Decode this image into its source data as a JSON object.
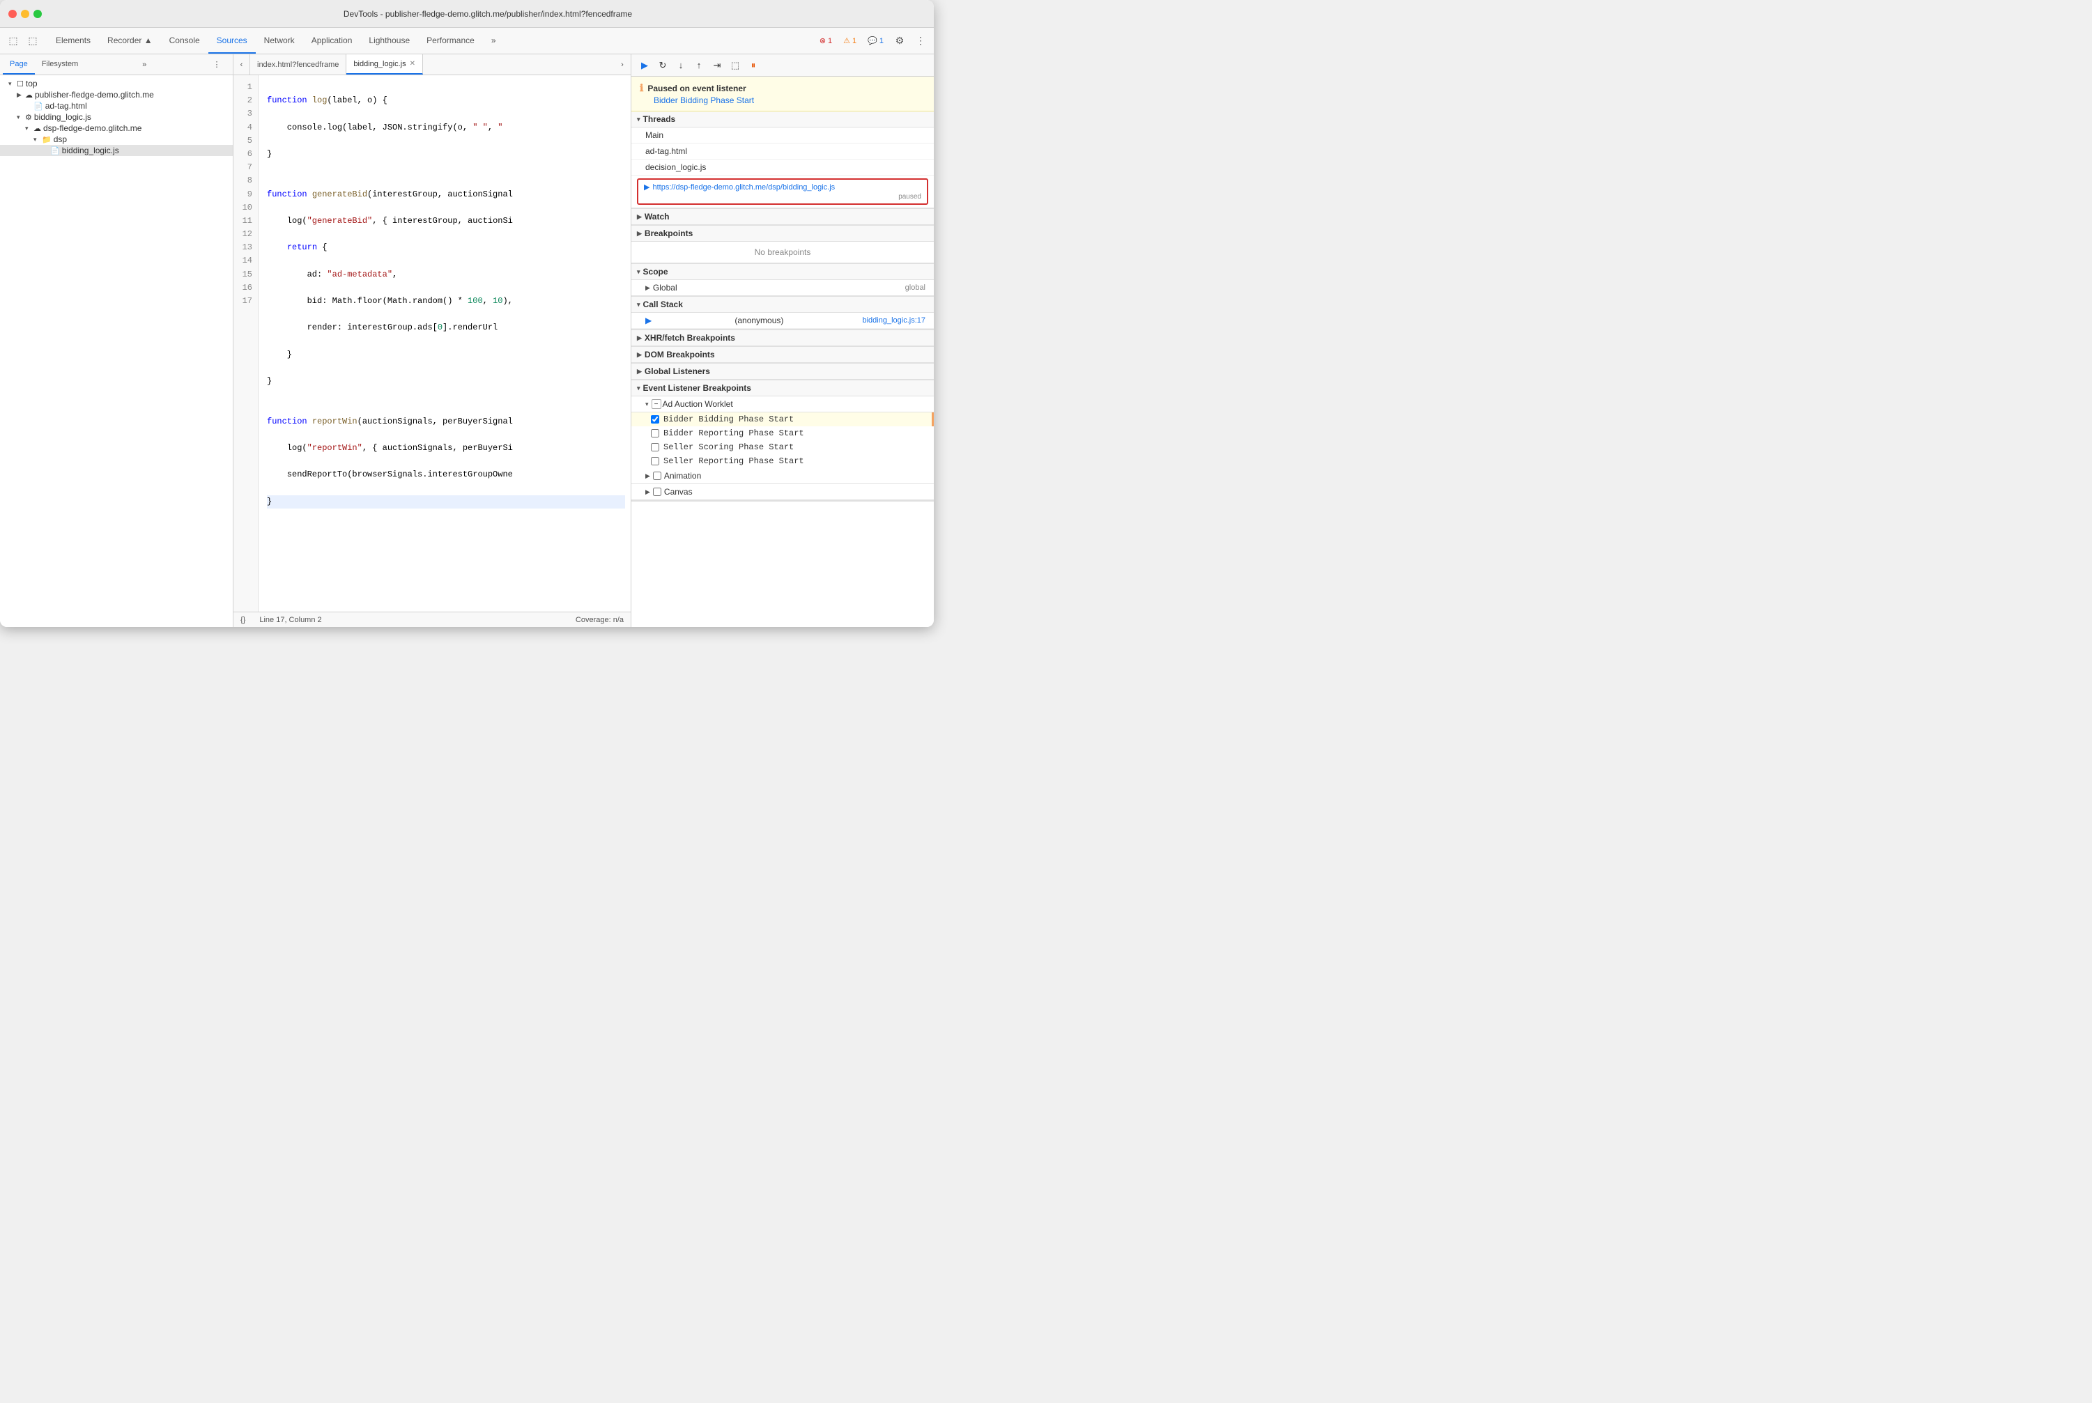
{
  "window": {
    "title": "DevTools - publisher-fledge-demo.glitch.me/publisher/index.html?fencedframe"
  },
  "toolbar": {
    "tabs": [
      {
        "label": "Elements",
        "active": false
      },
      {
        "label": "Recorder ▲",
        "active": false
      },
      {
        "label": "Console",
        "active": false
      },
      {
        "label": "Sources",
        "active": true
      },
      {
        "label": "Network",
        "active": false
      },
      {
        "label": "Application",
        "active": false
      },
      {
        "label": "Lighthouse",
        "active": false
      },
      {
        "label": "Performance",
        "active": false
      },
      {
        "label": "»",
        "active": false
      }
    ],
    "badges": {
      "error": "1",
      "warning": "1",
      "info": "1"
    }
  },
  "left_panel": {
    "tabs": [
      "Page",
      "Filesystem",
      "»"
    ],
    "active_tab": "Page",
    "tree": [
      {
        "level": 0,
        "type": "folder",
        "label": "top",
        "expanded": true,
        "arrow": "▾"
      },
      {
        "level": 1,
        "type": "cloud",
        "label": "publisher-fledge-demo.glitch.me",
        "expanded": false,
        "arrow": "▶"
      },
      {
        "level": 2,
        "type": "file",
        "label": "ad-tag.html",
        "arrow": ""
      },
      {
        "level": 1,
        "type": "gear",
        "label": "bidding_logic.js",
        "expanded": true,
        "arrow": "▾"
      },
      {
        "level": 2,
        "type": "cloud",
        "label": "dsp-fledge-demo.glitch.me",
        "expanded": true,
        "arrow": "▾"
      },
      {
        "level": 3,
        "type": "folder",
        "label": "dsp",
        "expanded": true,
        "arrow": "▾"
      },
      {
        "level": 4,
        "type": "js",
        "label": "bidding_logic.js",
        "selected": true,
        "arrow": ""
      }
    ]
  },
  "editor_tabs": [
    {
      "label": "index.html?fencedframe",
      "active": false,
      "closable": false
    },
    {
      "label": "bidding_logic.js",
      "active": true,
      "closable": true
    }
  ],
  "code": {
    "lines": [
      {
        "num": 1,
        "text": "function log(label, o) {"
      },
      {
        "num": 2,
        "text": "    console.log(label, JSON.stringify(o, \" \", \""
      },
      {
        "num": 3,
        "text": "}"
      },
      {
        "num": 4,
        "text": ""
      },
      {
        "num": 5,
        "text": "function generateBid(interestGroup, auctionSignal"
      },
      {
        "num": 6,
        "text": "    log(\"generateBid\", { interestGroup, auctionSi"
      },
      {
        "num": 7,
        "text": "    return {"
      },
      {
        "num": 8,
        "text": "        ad: \"ad-metadata\","
      },
      {
        "num": 9,
        "text": "        bid: Math.floor(Math.random() * 100, 10),"
      },
      {
        "num": 10,
        "text": "        render: interestGroup.ads[0].renderUrl"
      },
      {
        "num": 11,
        "text": "    }"
      },
      {
        "num": 12,
        "text": "}"
      },
      {
        "num": 13,
        "text": ""
      },
      {
        "num": 14,
        "text": "function reportWin(auctionSignals, perBuyerSignal"
      },
      {
        "num": 15,
        "text": "    log(\"reportWin\", { auctionSignals, perBuyerSi"
      },
      {
        "num": 16,
        "text": "    sendReportTo(browserSignals.interestGroupOwne"
      },
      {
        "num": 17,
        "text": "}",
        "highlighted": true
      }
    ]
  },
  "status_bar": {
    "format": "{}",
    "position": "Line 17, Column 2",
    "coverage": "Coverage: n/a"
  },
  "right_panel": {
    "paused_banner": {
      "title": "Paused on event listener",
      "subtitle": "Bidder Bidding Phase Start"
    },
    "threads": {
      "header": "Threads",
      "items": [
        {
          "label": "Main"
        },
        {
          "label": "ad-tag.html"
        },
        {
          "label": "decision_logic.js"
        },
        {
          "url": "https://dsp-fledge-demo.glitch.me/dsp/bidding_logic.js",
          "paused": "paused",
          "active": true
        }
      ]
    },
    "watch": {
      "header": "Watch"
    },
    "breakpoints": {
      "header": "Breakpoints",
      "content": "No breakpoints"
    },
    "scope": {
      "header": "Scope",
      "items": [
        {
          "label": "Global",
          "value": "global"
        }
      ]
    },
    "call_stack": {
      "header": "Call Stack",
      "items": [
        {
          "label": "(anonymous)",
          "location": "bidding_logic.js:17"
        }
      ]
    },
    "xhr_breakpoints": {
      "header": "XHR/fetch Breakpoints"
    },
    "dom_breakpoints": {
      "header": "DOM Breakpoints"
    },
    "global_listeners": {
      "header": "Global Listeners"
    },
    "event_listener_breakpoints": {
      "header": "Event Listener Breakpoints",
      "sections": [
        {
          "label": "Ad Auction Worklet",
          "expanded": true,
          "items": [
            {
              "label": "Bidder Bidding Phase Start",
              "checked": true,
              "highlighted": true
            },
            {
              "label": "Bidder Reporting Phase Start",
              "checked": false
            },
            {
              "label": "Seller Scoring Phase Start",
              "checked": false
            },
            {
              "label": "Seller Reporting Phase Start",
              "checked": false
            }
          ]
        },
        {
          "label": "Animation",
          "expanded": false
        },
        {
          "label": "Canvas",
          "expanded": false
        }
      ]
    }
  }
}
